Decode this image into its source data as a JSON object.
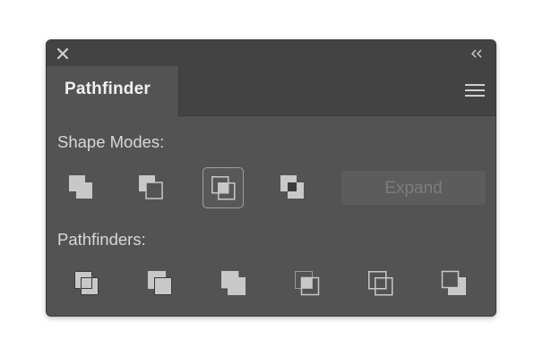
{
  "panel": {
    "tab_label": "Pathfinder"
  },
  "shape_modes": {
    "label": "Shape Modes:",
    "buttons": [
      {
        "name": "unite",
        "icon": "unite-icon"
      },
      {
        "name": "minus-front",
        "icon": "minus-front-icon"
      },
      {
        "name": "intersect",
        "icon": "intersect-icon",
        "active": true
      },
      {
        "name": "exclude",
        "icon": "exclude-icon"
      }
    ],
    "expand_label": "Expand"
  },
  "pathfinders": {
    "label": "Pathfinders:",
    "buttons": [
      {
        "name": "divide",
        "icon": "divide-icon"
      },
      {
        "name": "trim",
        "icon": "trim-icon"
      },
      {
        "name": "merge",
        "icon": "merge-icon"
      },
      {
        "name": "crop",
        "icon": "crop-icon"
      },
      {
        "name": "outline",
        "icon": "outline-icon"
      },
      {
        "name": "minus-back",
        "icon": "minus-back-icon"
      }
    ]
  },
  "colors": {
    "panel_bg": "#535353",
    "header_bg": "#434343",
    "icon_fill": "#c8c8c8",
    "icon_dark": "#3a3a3a"
  }
}
